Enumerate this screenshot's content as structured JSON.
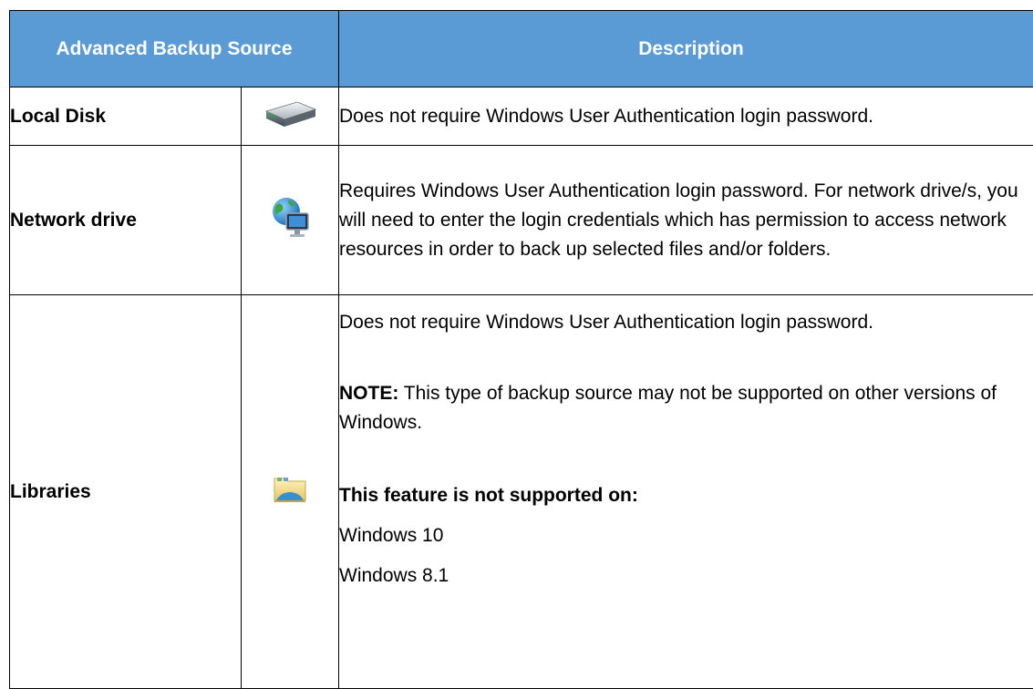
{
  "table": {
    "header": {
      "source": "Advanced Backup Source",
      "description": "Description"
    },
    "rows": [
      {
        "name": "Local Disk",
        "icon": "hard-drive-icon",
        "description": "Does not require Windows User Authentication login password."
      },
      {
        "name": "Network drive",
        "icon": "network-globe-icon",
        "description": "Requires Windows User Authentication login password. For network drive/s, you will need to enter the login credentials which has permission to access network resources in order to back up selected files and/or folders."
      },
      {
        "name": "Libraries",
        "icon": "library-folder-icon",
        "description": "Does not require Windows User Authentication login password.",
        "note_label": "NOTE:",
        "note_text": " This type of backup source may not be supported on other versions of Windows.",
        "unsupported_title": "This feature is not supported on:",
        "unsupported_list": [
          "Windows 10",
          "Windows 8.1"
        ]
      }
    ]
  },
  "colors": {
    "header_bg": "#5b9bd5",
    "header_text": "#ffffff",
    "border": "#000000"
  }
}
